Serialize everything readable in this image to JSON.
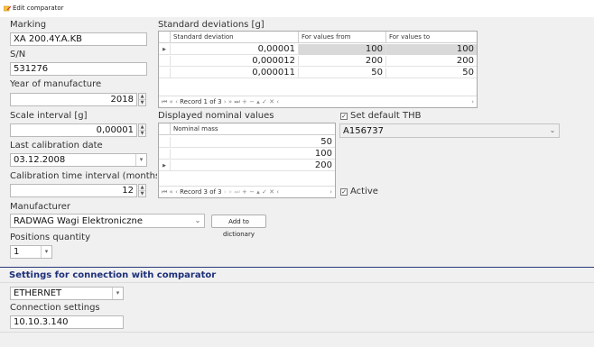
{
  "window": {
    "title": "Edit comparator"
  },
  "form": {
    "marking_label": "Marking",
    "marking_value": "XA 200.4Y.A.KB",
    "sn_label": "S/N",
    "sn_value": "531276",
    "year_label": "Year of manufacture",
    "year_value": "2018",
    "scale_label": "Scale interval [g]",
    "scale_value": "0,00001",
    "calib_date_label": "Last calibration date",
    "calib_date_value": "03.12.2008",
    "calib_interval_label": "Calibration time interval (months quantity)",
    "calib_interval_value": "12",
    "manufacturer_label": "Manufacturer",
    "manufacturer_value": "RADWAG Wagi Elektroniczne",
    "add_dict_label": "Add to dictionary",
    "positions_label": "Positions quantity",
    "positions_value": "1"
  },
  "std_dev": {
    "title": "Standard deviations [g]",
    "columns": [
      "Standard deviation",
      "For values from",
      "For values to"
    ],
    "rows": [
      [
        "0,00001",
        "100",
        "100"
      ],
      [
        "0,000012",
        "200",
        "200"
      ],
      [
        "0,000011",
        "50",
        "50"
      ]
    ],
    "record_text": "Record 1 of 3"
  },
  "nominal": {
    "title": "Displayed nominal values",
    "column": "Nominal mass",
    "rows": [
      "50",
      "100",
      "200"
    ],
    "record_text": "Record 3 of 3"
  },
  "thb": {
    "checkbox_label": "Set default THB",
    "value": "A156737"
  },
  "active": {
    "label": "Active"
  },
  "connection": {
    "section_title": "Settings for connection with comparator",
    "type_value": "ETHERNET",
    "settings_label": "Connection settings",
    "settings_value": "10.10.3.140"
  },
  "icons": {
    "window": "edit-window-icon",
    "dropdown": "chevron-down-icon",
    "spin": "spin-up-down-icon",
    "nav": "record-navigator-icons",
    "check": "checkmark-icon"
  },
  "colors": {
    "section_title": "#1c2f7a",
    "selected_cell": "#d9d9d9"
  }
}
